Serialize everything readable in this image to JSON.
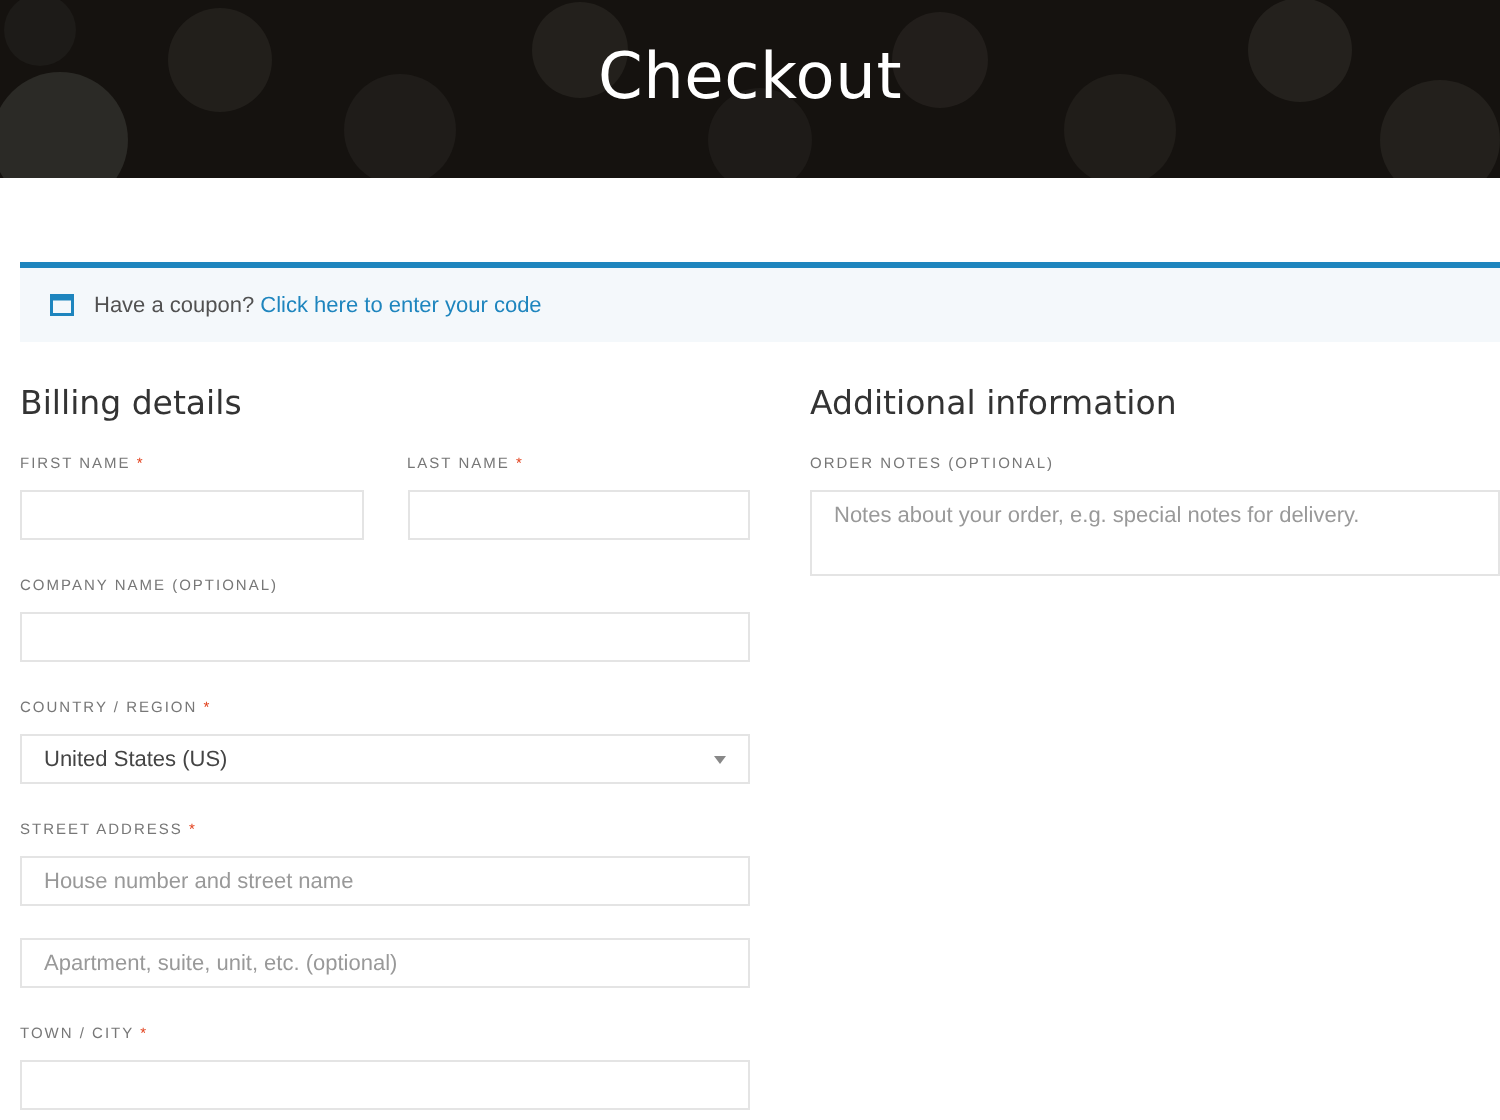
{
  "header": {
    "title": "Checkout"
  },
  "coupon_notice": {
    "text": "Have a coupon?",
    "link": "Click here to enter your code"
  },
  "required_mark": "*",
  "billing": {
    "heading": "Billing details",
    "rows": [
      [
        {
          "kind": "text",
          "label": "FIRST NAME",
          "required": true
        },
        {
          "kind": "text",
          "label": "LAST NAME",
          "required": true
        }
      ],
      [
        {
          "kind": "text",
          "label": "COMPANY NAME (OPTIONAL)",
          "required": false
        }
      ],
      [
        {
          "kind": "select",
          "label": "COUNTRY / REGION",
          "required": true,
          "value": "United States (US)"
        }
      ],
      [
        {
          "kind": "text",
          "label": "STREET ADDRESS",
          "required": true,
          "placeholder": "House number and street name"
        }
      ],
      [
        {
          "kind": "text",
          "placeholder": "Apartment, suite, unit, etc. (optional)"
        }
      ],
      [
        {
          "kind": "text",
          "label": "TOWN / CITY",
          "required": true
        }
      ]
    ]
  },
  "additional": {
    "heading": "Additional information",
    "fields": [
      {
        "kind": "textarea",
        "label": "ORDER NOTES (OPTIONAL)",
        "required": false,
        "placeholder": "Notes about your order, e.g. special notes for delivery."
      }
    ]
  }
}
